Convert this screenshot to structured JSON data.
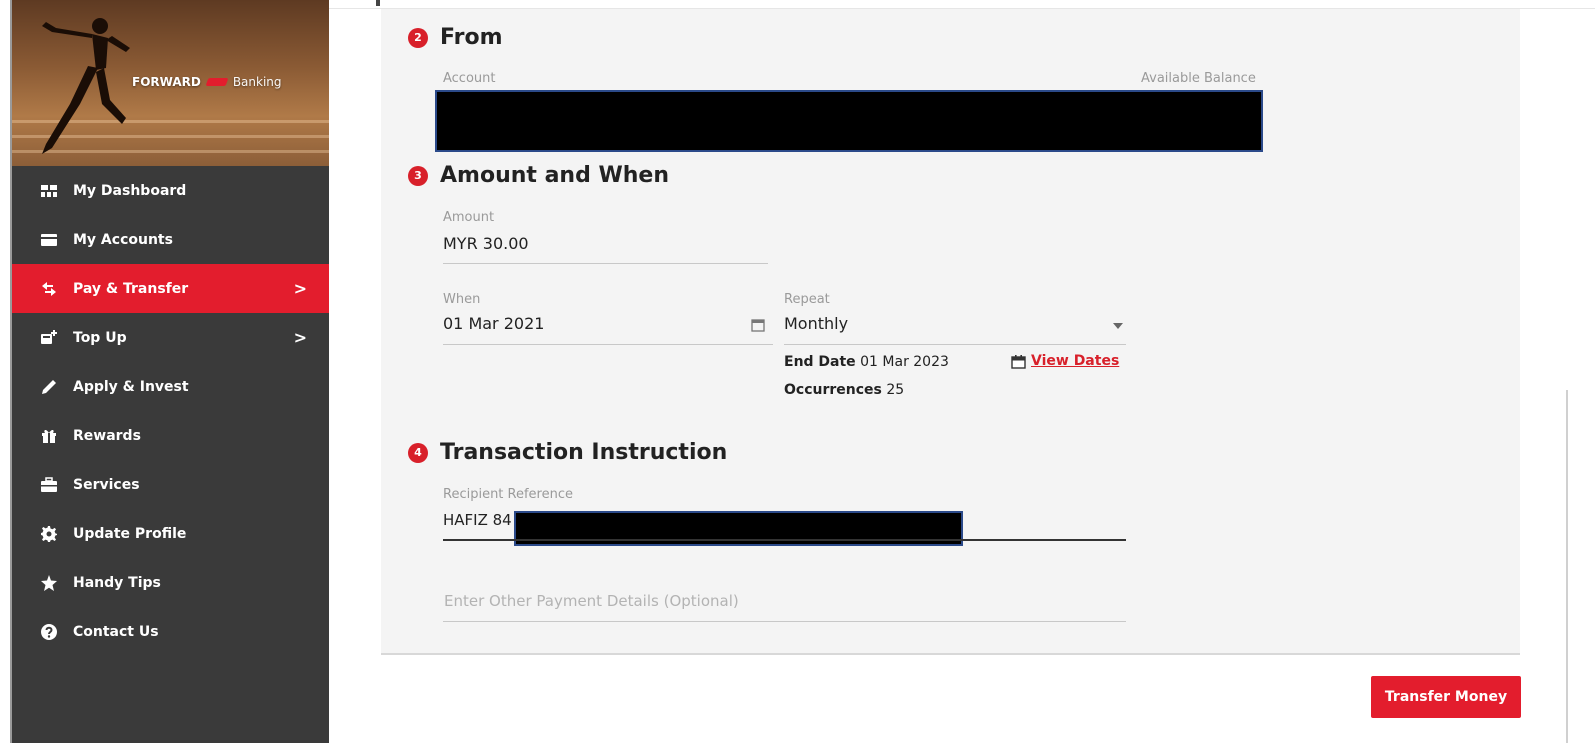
{
  "brand": {
    "name_strong": "FORWARD",
    "name_light": "Banking"
  },
  "sidebar": {
    "items": [
      {
        "label": "My Dashboard",
        "icon": "dashboard-icon"
      },
      {
        "label": "My Accounts",
        "icon": "accounts-card-icon"
      },
      {
        "label": "Pay & Transfer",
        "icon": "transfer-arrows-icon",
        "active": true,
        "chevron": ">"
      },
      {
        "label": "Top Up",
        "icon": "top-up-icon",
        "chevron": ">"
      },
      {
        "label": "Apply & Invest",
        "icon": "pen-icon"
      },
      {
        "label": "Rewards",
        "icon": "gift-icon"
      },
      {
        "label": "Services",
        "icon": "briefcase-icon"
      },
      {
        "label": "Update Profile",
        "icon": "gear-icon"
      },
      {
        "label": "Handy Tips",
        "icon": "star-icon"
      },
      {
        "label": "Contact Us",
        "icon": "question-icon"
      }
    ]
  },
  "from": {
    "step": "2",
    "title": "From",
    "account_label": "Account",
    "balance_label": "Available Balance"
  },
  "amount_when": {
    "step": "3",
    "title": "Amount and When",
    "amount_label": "Amount",
    "amount_value": "MYR 30.00",
    "when_label": "When",
    "when_value": "01 Mar 2021",
    "repeat_label": "Repeat",
    "repeat_value": "Monthly",
    "end_date_label": "End Date",
    "end_date_value": "01 Mar 2023",
    "occurrences_label": "Occurrences",
    "occurrences_value": "25",
    "view_dates_label": "View Dates"
  },
  "instruction": {
    "step": "4",
    "title": "Transaction Instruction",
    "recipient_ref_label": "Recipient Reference",
    "recipient_ref_value": "HAFIZ 84",
    "other_details_placeholder": "Enter Other Payment Details (Optional)"
  },
  "actions": {
    "transfer_label": "Transfer Money"
  },
  "colors": {
    "accent": "#e31d2d",
    "sidebar": "#3a3a3a",
    "content_bg": "#f4f4f4"
  }
}
